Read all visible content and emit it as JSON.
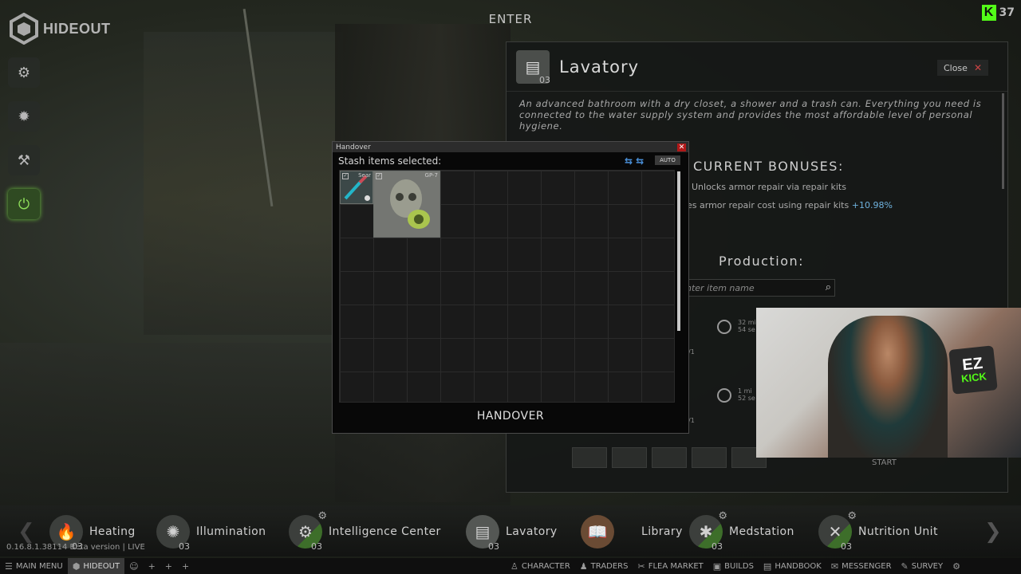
{
  "top": {
    "logo_text": "HIDEOUT",
    "enter_label": "ENTER",
    "kick_letter": "K",
    "viewer_count": "37"
  },
  "left_nav": [
    {
      "icon": "cogs-icon",
      "glyph": "⚙"
    },
    {
      "icon": "lightbulb-icon",
      "glyph": "✹"
    },
    {
      "icon": "hammer-icon",
      "glyph": "⚒"
    },
    {
      "icon": "power-icon",
      "glyph": "⏻",
      "active": true
    }
  ],
  "lavatory": {
    "title": "Lavatory",
    "level": "03",
    "close_label": "Close",
    "close_x": "✕",
    "description": "An advanced bathroom with a dry closet, a shower and a trash can. Everything you need is connected to the water supply system and provides the most affordable level of personal hygiene.",
    "bonuses_title": "CURRENT BONUSES:",
    "bonus_1": "Unlocks armor repair via repair kits",
    "bonus_2_text": "es armor repair cost using repair kits",
    "bonus_2_value": "+10.98%",
    "production_title": "Production:",
    "search_placeholder": "nter item name",
    "row1_time": "32 mi\n54 se",
    "row1_count": "/1",
    "row2_time": "1 mi\n52 se",
    "row2_count": "/1",
    "start_label": "START"
  },
  "handover": {
    "window_title": "Handover",
    "close_x": "✕",
    "stash_label": "Stash items selected:",
    "auto_label": "AUTO",
    "items": [
      {
        "name": "Sear",
        "icon": "syringe-icon"
      },
      {
        "name": "GP-7",
        "icon": "gas-mask-icon"
      }
    ],
    "button_label": "HANDOVER"
  },
  "modules": [
    {
      "name": "Heating",
      "level": "03",
      "glyph": "🔥"
    },
    {
      "name": "Illumination",
      "level": "03",
      "glyph": "✺"
    },
    {
      "name": "Intelligence Center",
      "level": "03",
      "glyph": "⚙"
    },
    {
      "name": "Lavatory",
      "level": "03",
      "glyph": "▤"
    },
    {
      "name": "Library",
      "level": "",
      "glyph": "📖"
    },
    {
      "name": "Medstation",
      "level": "03",
      "glyph": "✱"
    },
    {
      "name": "Nutrition Unit",
      "level": "03",
      "glyph": "✕"
    }
  ],
  "version_text": "0.16.8.1.38114 Beta version | LIVE",
  "taskbar": {
    "main_menu": "MAIN MENU",
    "hideout": "HIDEOUT",
    "character": "CHARACTER",
    "traders": "TRADERS",
    "flea_market": "FLEA MARKET",
    "builds": "BUILDS",
    "handbook": "HANDBOOK",
    "messenger": "MESSENGER",
    "survey": "SURVEY"
  },
  "webcam": {
    "sticker_top": "EZ",
    "sticker_bottom": "KICK"
  },
  "colors": {
    "accent_green": "#53fc18",
    "bonus_blue": "#6fb2de",
    "close_red": "#b01818"
  }
}
